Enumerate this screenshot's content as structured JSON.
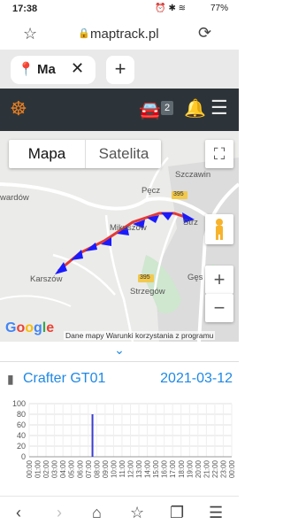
{
  "status_bar": {
    "time": "17:38",
    "battery": "77%"
  },
  "browser": {
    "url": "maptrack.pl",
    "tabs": [
      {
        "label": "Ma"
      }
    ],
    "new_tab_symbol": "+"
  },
  "app_header": {
    "vehicle_count": "2"
  },
  "map": {
    "type_buttons": [
      "Mapa",
      "Satelita"
    ],
    "active_type": "Mapa",
    "places": [
      "Szczawin",
      "Pęcz",
      "Mikuszów",
      "Strzegów",
      "Karszów",
      "Gęs",
      "Strz",
      "wardów"
    ],
    "road_numbers": [
      "395",
      "395"
    ],
    "provider_logo": "Google",
    "attribution": "Dane mapy   Warunki korzystania z programu",
    "route_color": "#e53935",
    "marker_color": "#1a1aff"
  },
  "vehicle": {
    "name": "Crafter GT01",
    "date": "2021-03-12"
  },
  "chart_data": {
    "type": "bar",
    "ylim": [
      0,
      100
    ],
    "yticks": [
      0,
      20,
      40,
      60,
      80,
      100
    ],
    "categories": [
      "00:00",
      "01:00",
      "02:00",
      "03:00",
      "04:00",
      "05:00",
      "06:00",
      "07:00",
      "08:00",
      "09:00",
      "10:00",
      "11:00",
      "12:00",
      "13:00",
      "14:00",
      "15:00",
      "16:00",
      "17:00",
      "18:00",
      "19:00",
      "20:00",
      "21:00",
      "22:00",
      "23:00",
      "00:00"
    ],
    "values": [
      0,
      0,
      0,
      0,
      0,
      0,
      0,
      0,
      0,
      0,
      0,
      0,
      0,
      0,
      0,
      0,
      0,
      0,
      0,
      0,
      0,
      0,
      0,
      0,
      0
    ],
    "spike": {
      "time_hours": 7.5,
      "value": 80
    },
    "bar_color": "#3b3bd1"
  },
  "icons": {
    "star": "star-outline-icon",
    "reload": "reload-icon",
    "lock": "lock-icon",
    "logo": "ship-wheel-icon",
    "car": "car-icon",
    "bell": "bell-icon",
    "menu": "hamburger-menu-icon"
  },
  "colors": {
    "accent": "#1e88e5",
    "header_bg": "#2d3439",
    "logo": "#e67e22"
  }
}
